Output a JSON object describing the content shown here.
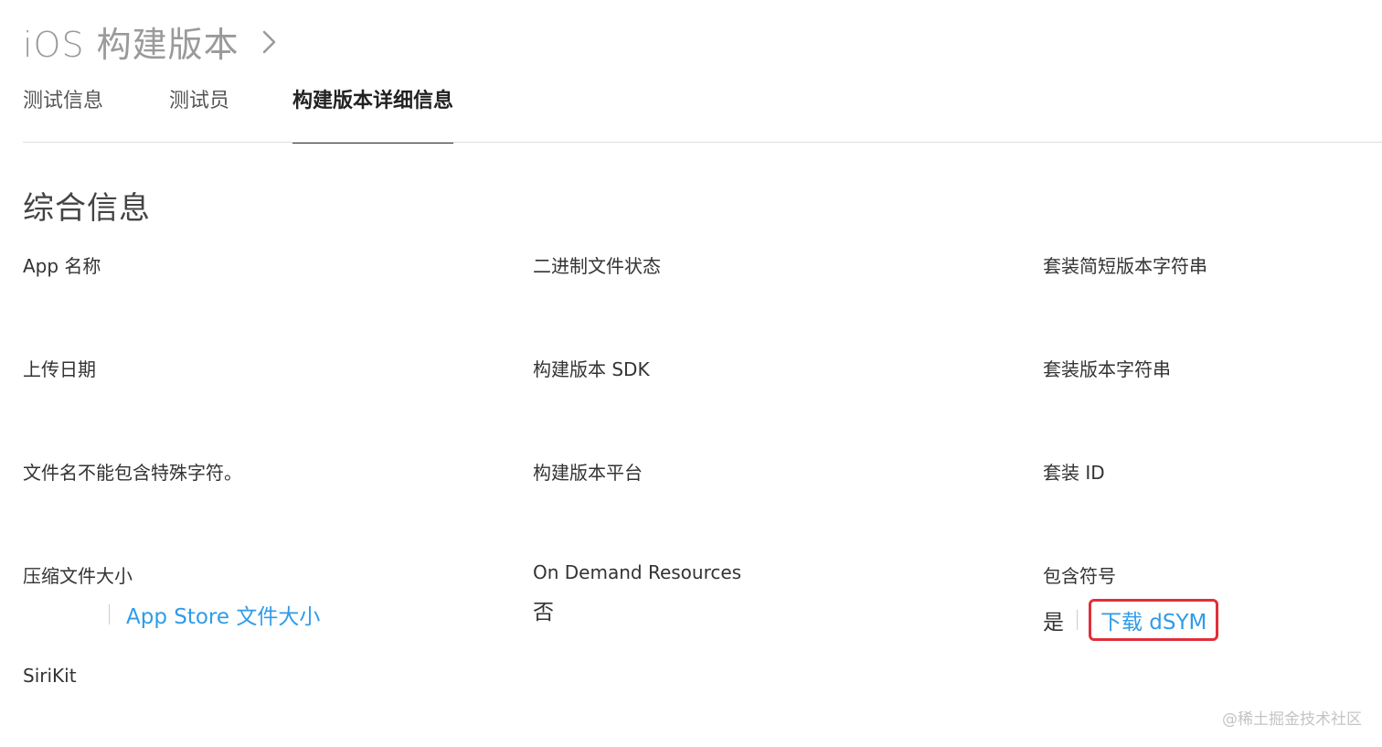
{
  "breadcrumb": {
    "title": "iOS 构建版本",
    "chevron_icon": "chevron-right-icon"
  },
  "tabs": [
    {
      "label": "测试信息",
      "active": false
    },
    {
      "label": "测试员",
      "active": false
    },
    {
      "label": "构建版本详细信息",
      "active": true
    }
  ],
  "section": {
    "title": "综合信息"
  },
  "fields": {
    "app_name": {
      "label": "App 名称"
    },
    "binary_status": {
      "label": "二进制文件状态"
    },
    "short_version": {
      "label": "套装简短版本字符串"
    },
    "upload_date": {
      "label": "上传日期"
    },
    "build_sdk": {
      "label": "构建版本 SDK"
    },
    "bundle_version": {
      "label": "套装版本字符串"
    },
    "filename_note": {
      "label": "文件名不能包含特殊字符。"
    },
    "build_platform": {
      "label": "构建版本平台"
    },
    "bundle_id": {
      "label": "套装 ID"
    },
    "compressed_size": {
      "label": "压缩文件大小",
      "link": "App Store 文件大小"
    },
    "on_demand": {
      "label": "On Demand Resources",
      "value": "否"
    },
    "symbols": {
      "label": "包含符号",
      "value": "是",
      "link": "下载 dSYM"
    },
    "sirikit": {
      "label": "SiriKit"
    }
  },
  "colors": {
    "link": "#2f9be8",
    "highlight": "#e0303a"
  },
  "watermark": "@稀土掘金技术社区"
}
